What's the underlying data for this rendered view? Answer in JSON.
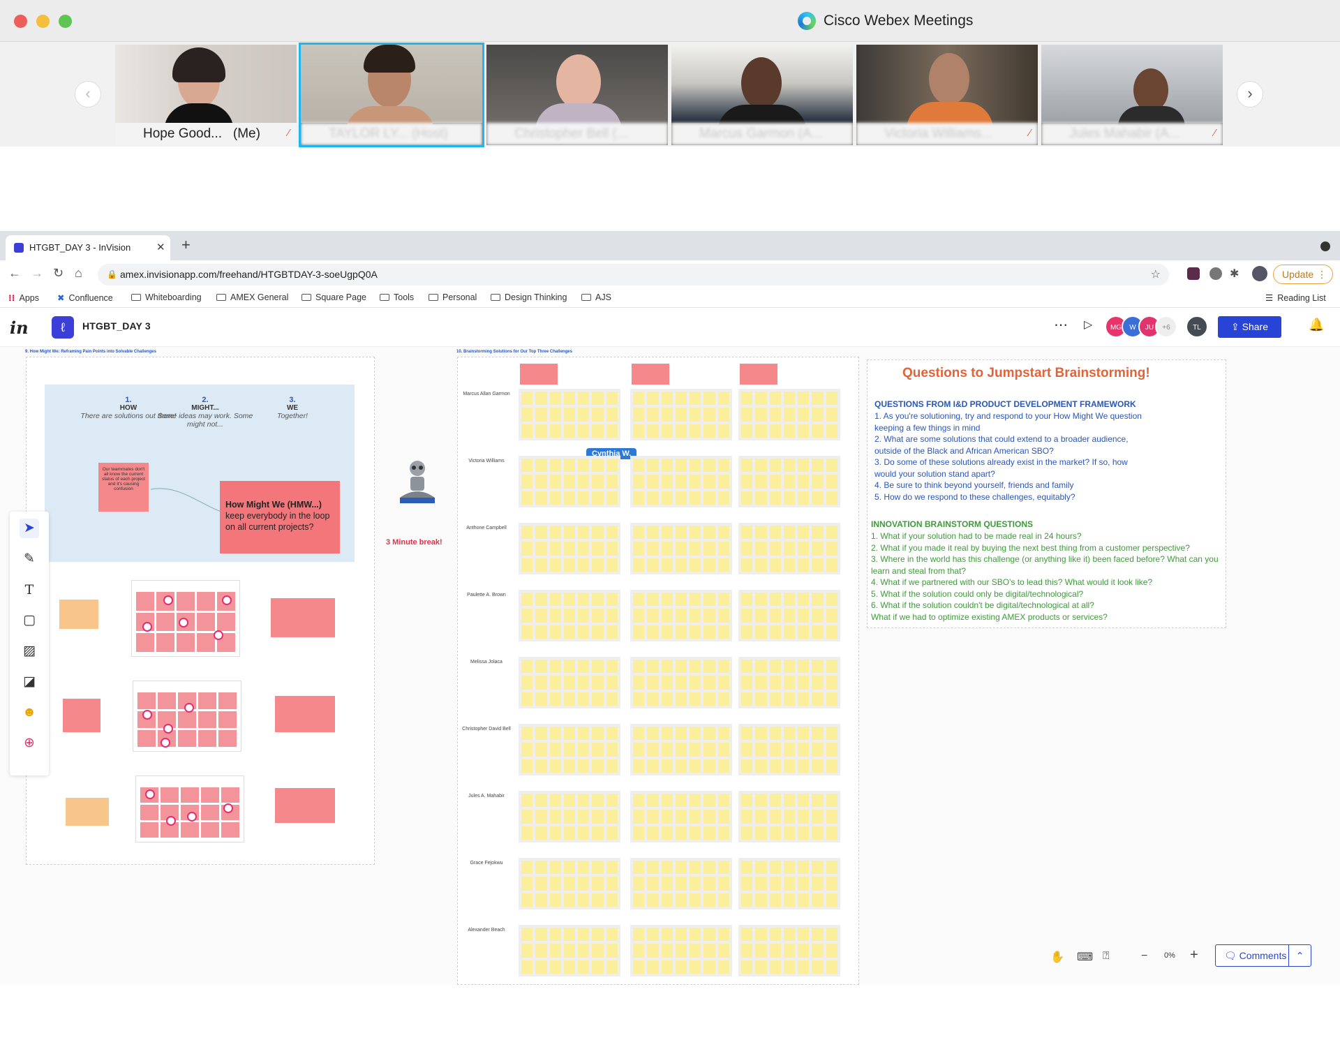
{
  "colors": {
    "accent": "#2744d6",
    "invision_brand": "#3b3fd8",
    "hmw_pink": "#f3767b",
    "sticky_yellow": "#fcef9c",
    "title_orange": "#e0643a",
    "section_blue": "#2a56b8",
    "section_green": "#3f9a3a"
  },
  "webex": {
    "title": "Cisco Webex Meetings"
  },
  "participants": [
    {
      "name": "Hope Good...",
      "suffix": "(Me)",
      "icon": "phone-icon"
    },
    {
      "name": "TAYLOR LY... (Host)",
      "suffix": "",
      "icon": "webex-icon"
    },
    {
      "name": "Christopher Bell (...",
      "suffix": "",
      "icon": "webex-icon"
    },
    {
      "name": "Marcus Garmon (A...",
      "suffix": "",
      "icon": "webex-icon"
    },
    {
      "name": "Victoria Williams...",
      "suffix": "",
      "icon": "webex-icon"
    },
    {
      "name": "Jules Mahabir (A...",
      "suffix": "",
      "icon": "webex-icon"
    }
  ],
  "browser": {
    "tab_title": "HTGBT_DAY 3 - InVision",
    "url": "amex.invisionapp.com/freehand/HTGBTDAY-3-soeUgpQ0A",
    "update_label": "Update",
    "bookmarks": [
      "Apps",
      "Confluence",
      "Whiteboarding",
      "AMEX General",
      "Square Page",
      "Tools",
      "Personal",
      "Design Thinking",
      "AJS"
    ],
    "reading_list": "Reading List"
  },
  "invision": {
    "logo": "in",
    "board_title": "HTGBT_DAY 3",
    "avatars": [
      "MG",
      "W",
      "JU"
    ],
    "avatar_more": "+6",
    "user_avatar": "TL",
    "share_label": "Share"
  },
  "canvas": {
    "section9_title": "9.   How Might We: Reframing Pain Points into Solvable Challenges",
    "section10_title": "10.   Brainstorming Solutions for Our Top Three Challenges",
    "steps": [
      {
        "num": "1.",
        "word": "HOW",
        "desc": "There are solutions out there!"
      },
      {
        "num": "2.",
        "word": "MIGHT...",
        "desc": "Some ideas may work. Some might not..."
      },
      {
        "num": "3.",
        "word": "WE",
        "desc": "Together!"
      }
    ],
    "teammates_note": "Our teammates don't all know the current status of each project and it's causing confusion",
    "hmw_title": "How Might We (HMW...)",
    "hmw_body": "keep everybody in the loop on all current projects?",
    "break_label": "3 Minute break!",
    "cursor_label": "Cynthia W.",
    "row_names": [
      "Marcus Allan Garmon",
      "Victoria Williams",
      "Anthone Campbell",
      "Paulette A. Brown",
      "Melissa Jolaca",
      "Christopher David Bell",
      "Jules A. Mahabir",
      "Grace Fejokwu",
      "Alexander Beach"
    ],
    "zoom": "0%",
    "comments_label": "Comments"
  },
  "questions": {
    "title": "Questions to Jumpstart Brainstorming!",
    "section1": "QUESTIONS FROM I&D PRODUCT DEVELOPMENT FRAMEWORK",
    "list1": [
      "1.   As you're solutioning, try and respond to your How Might We question keeping a few things in mind",
      "2.   What are some solutions that could extend to a broader audience, outside of the Black and African American SBO?",
      "3.   Do some of these solutions already exist in the market? If so, how would your solution stand apart?",
      "4.   Be sure to think beyond yourself, friends and family",
      "5.   How do we respond to these challenges, equitably?"
    ],
    "section2": "INNOVATION BRAINSTORM QUESTIONS",
    "list2": [
      "1.   What if your solution had to be made real in 24 hours?",
      "2.   What if you made it real by buying the next best thing from a customer perspective?",
      "3.   Where in the world has this challenge (or anything like it) been faced before? What can you learn and steal from that?",
      "4.   What if we partnered with our SBO's to lead this? What would it look like?",
      "5.   What if the solution could only be digital/technological?",
      "6.   What if the solution couldn't be digital/technological at all?",
      "What if we had to optimize existing AMEX products or services?"
    ]
  }
}
